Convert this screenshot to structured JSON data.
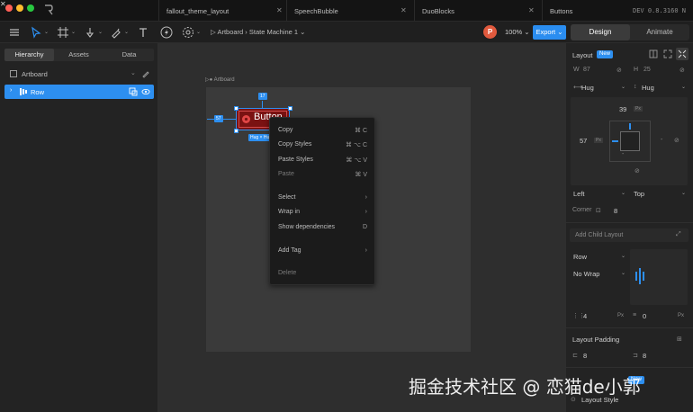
{
  "tabs": [
    {
      "label": "fallout_theme_layout"
    },
    {
      "label": "SpeechBubble"
    },
    {
      "label": "DuoBlocks"
    },
    {
      "label": "Buttons"
    }
  ],
  "version": "DEV 0.8.3160 N",
  "toolbar": {
    "breadcrumb": "Artboard › State Machine 1",
    "avatar_initial": "P",
    "zoom": "100%",
    "export_label": "Export",
    "modes": [
      "Design",
      "Animate"
    ],
    "active_mode": "Design"
  },
  "left_panel": {
    "tabs": [
      "Hierarchy",
      "Assets",
      "Data"
    ],
    "active_tab": "Hierarchy",
    "tree": [
      {
        "label": "Artboard"
      },
      {
        "label": "Row",
        "selected": true
      }
    ]
  },
  "canvas": {
    "artboard_label": "Artboard",
    "button_text": "Button",
    "badges": {
      "top": "17",
      "left": "57",
      "bottom": "Hug × Hug"
    }
  },
  "context_menu": {
    "items": [
      {
        "label": "Copy",
        "shortcut": "⌘ C"
      },
      {
        "label": "Copy Styles",
        "shortcut": "⌘ ⌥ C"
      },
      {
        "label": "Paste Styles",
        "shortcut": "⌘ ⌥ V"
      },
      {
        "label": "Paste",
        "shortcut": "⌘ V",
        "disabled": true
      },
      {
        "label": "Select",
        "shortcut": "›"
      },
      {
        "label": "Wrap in",
        "shortcut": "›"
      },
      {
        "label": "Show dependencies",
        "shortcut": "D"
      },
      {
        "label": "Add Tag",
        "shortcut": "›"
      },
      {
        "label": "Delete",
        "shortcut": "",
        "disabled": true
      }
    ]
  },
  "right_panel": {
    "layout_title": "Layout",
    "new_badge": "New",
    "w_label": "W",
    "w_value": "87",
    "h_label": "H",
    "h_value": "25",
    "w_mode": "Hug",
    "h_mode": "Hug",
    "top_value": "39",
    "left_value": "57",
    "px_unit": "Px",
    "align_h": "Left",
    "align_v": "Top",
    "corner_label": "Corner",
    "corner_value": "8",
    "add_child_layout": "Add Child Layout",
    "direction": "Row",
    "wrap": "No Wrap",
    "gap_value": "4",
    "gap_value2": "0",
    "padding_title": "Layout Padding",
    "padding_left": "8",
    "padding_right": "8",
    "layout_style": "Layout Style"
  },
  "watermark": "掘金技术社区 @ 恋猫de小郭",
  "colors": {
    "accent": "#2d8ff0",
    "export": "#2a8df0",
    "avatar": "#e0593d",
    "button_fill": "#7a1212"
  }
}
